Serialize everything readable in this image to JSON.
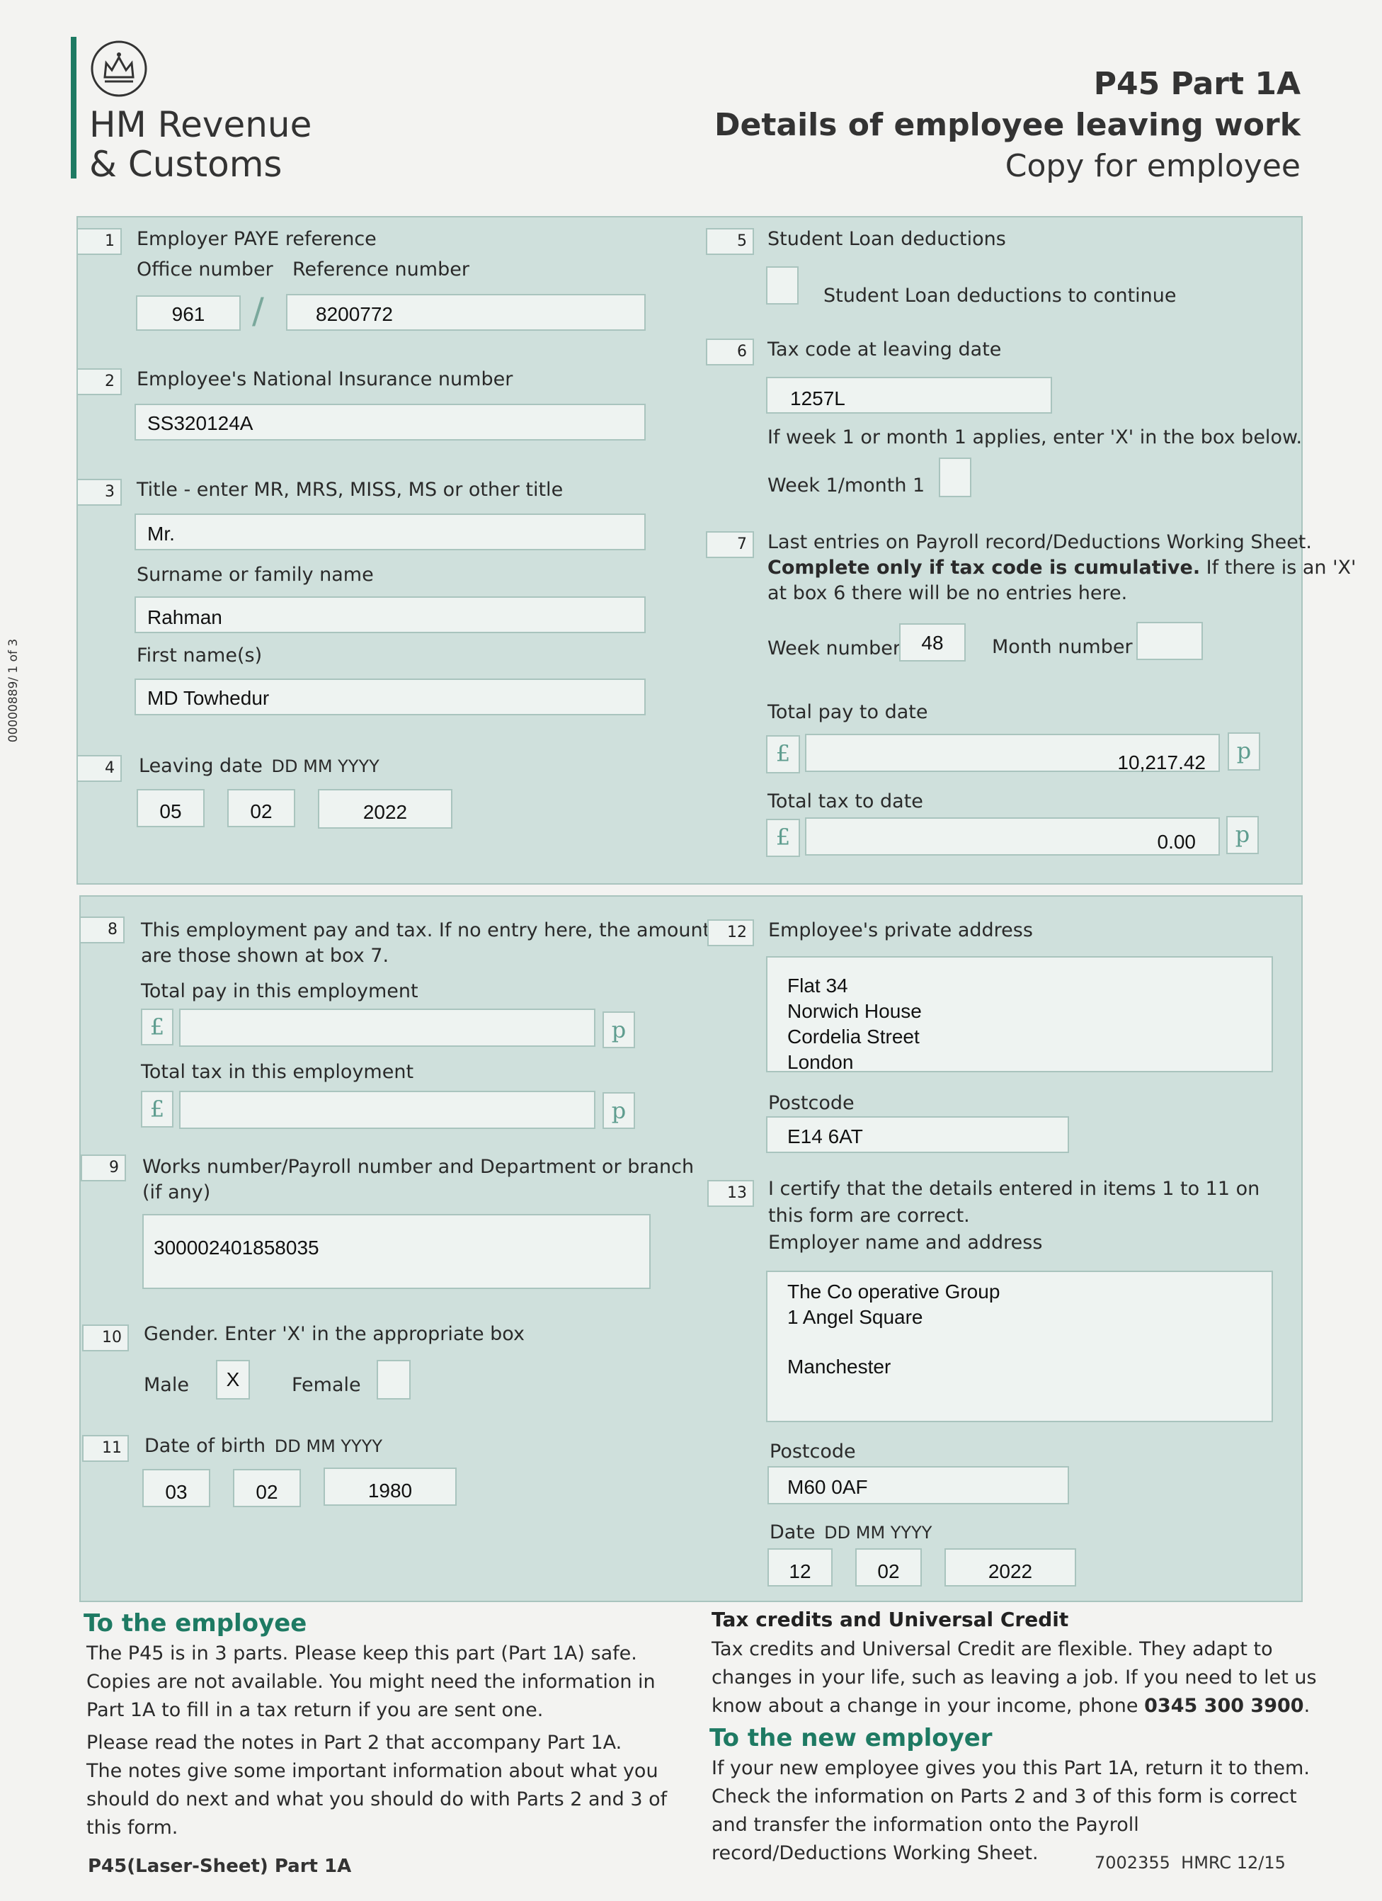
{
  "side_code": "00000889/ 1 of 3",
  "header": {
    "org_line1": "HM Revenue",
    "org_line2": "& Customs",
    "form_title": "P45 Part 1A",
    "form_subtitle": "Details of employee leaving work",
    "copy_label": "Copy for employee"
  },
  "colors": {
    "accent": "#1e7a63",
    "panel": "#cfe0dc",
    "box": "#eef3f1"
  },
  "box1": {
    "number": "1",
    "label": "Employer PAYE reference",
    "office_label": "Office number",
    "reference_label": "Reference number",
    "office_value": "961",
    "separator": "/",
    "reference_value": "8200772"
  },
  "box2": {
    "number": "2",
    "label": "Employee's National Insurance number",
    "value": "SS320124A"
  },
  "box3": {
    "number": "3",
    "label": "Title - enter MR, MRS, MISS, MS or other title",
    "title_value": "Mr.",
    "surname_label": "Surname or family name",
    "surname_value": "Rahman",
    "first_label": "First name(s)",
    "first_value": "MD Towhedur"
  },
  "box4": {
    "number": "4",
    "label": "Leaving date",
    "format": "DD MM YYYY",
    "dd": "05",
    "mm": "02",
    "yyyy": "2022"
  },
  "box5": {
    "number": "5",
    "label": "Student Loan deductions",
    "checkbox_label": "Student Loan deductions to continue",
    "checked": ""
  },
  "box6": {
    "number": "6",
    "label": "Tax code at leaving date",
    "value": "1257L",
    "note": "If week 1 or month 1 applies, enter 'X' in the box below.",
    "week1_label": "Week 1/month 1",
    "week1_value": ""
  },
  "box7": {
    "number": "7",
    "line1": "Last entries on Payroll record/Deductions Working Sheet.",
    "bold": "Complete only if tax code is cumulative.",
    "line2_rest": " If there is an 'X'",
    "line3": "at box 6 there will be no entries here.",
    "week_label": "Week number",
    "week_value": "48",
    "month_label": "Month number",
    "month_value": "",
    "total_pay_label": "Total pay to date",
    "total_pay_value": "10,217.42",
    "total_tax_label": "Total tax to date",
    "total_tax_value": "0.00",
    "pound": "£",
    "pence": "p"
  },
  "box8": {
    "number": "8",
    "line1": "This employment pay and tax. If no entry here, the amounts",
    "line2": "are those shown at box 7.",
    "pay_label": "Total pay in this employment",
    "pay_value": "",
    "tax_label": "Total tax in this employment",
    "tax_value": "",
    "pound": "£",
    "pence": "p"
  },
  "box9": {
    "number": "9",
    "line1": "Works number/Payroll number and Department or branch",
    "line2": "(if any)",
    "value": "300002401858035"
  },
  "box10": {
    "number": "10",
    "label": "Gender. Enter 'X' in the appropriate box",
    "male_label": "Male",
    "male_value": "X",
    "female_label": "Female",
    "female_value": ""
  },
  "box11": {
    "number": "11",
    "label": "Date of birth",
    "format": "DD MM YYYY",
    "dd": "03",
    "mm": "02",
    "yyyy": "1980"
  },
  "box12": {
    "number": "12",
    "label": "Employee's private address",
    "address": [
      "Flat 34",
      "Norwich House",
      "Cordelia Street",
      "London"
    ],
    "postcode_label": "Postcode",
    "postcode": "E14 6AT"
  },
  "box13": {
    "number": "13",
    "line1": "I certify that the details entered in items 1 to 11 on",
    "line2": "this form are correct.",
    "employer_label": "Employer name and address",
    "employer_address": [
      "The Co operative Group",
      "1 Angel Square",
      "",
      "Manchester"
    ],
    "postcode_label": "Postcode",
    "postcode": "M60 0AF",
    "date_label": "Date",
    "date_format": "DD MM YYYY",
    "dd": "12",
    "mm": "02",
    "yyyy": "2022"
  },
  "footer": {
    "employee_heading": "To the employee",
    "employee_p1": [
      "The P45 is in 3 parts. Please keep this part (Part 1A) safe.",
      "Copies are not available. You might need the information in",
      "Part 1A to fill in a tax return if you are sent one."
    ],
    "employee_p2": [
      "Please read the notes in Part 2 that accompany Part 1A.",
      "The notes give some important information about what you",
      "should do next and what you should do with Parts 2 and 3 of",
      "this form."
    ],
    "tax_credits_heading": "Tax credits and Universal Credit",
    "tax_credits_lines": [
      "Tax credits and Universal Credit are flexible. They adapt to",
      "changes in your life, such as leaving a job. If you need to let us"
    ],
    "tax_credits_last": "know about a change in your income, phone ",
    "phone": "0345 300 3900",
    "phone_end": ".",
    "new_employer_heading": "To the new employer",
    "new_employer_lines": [
      "If your new employee gives you this Part 1A, return it to them.",
      "Check the information on Parts 2 and 3 of this form is correct",
      "and transfer the information onto the Payroll",
      "record/Deductions Working Sheet."
    ],
    "form_code": "P45(Laser-Sheet) Part 1A",
    "ref_code": "7002355  HMRC 12/15"
  }
}
